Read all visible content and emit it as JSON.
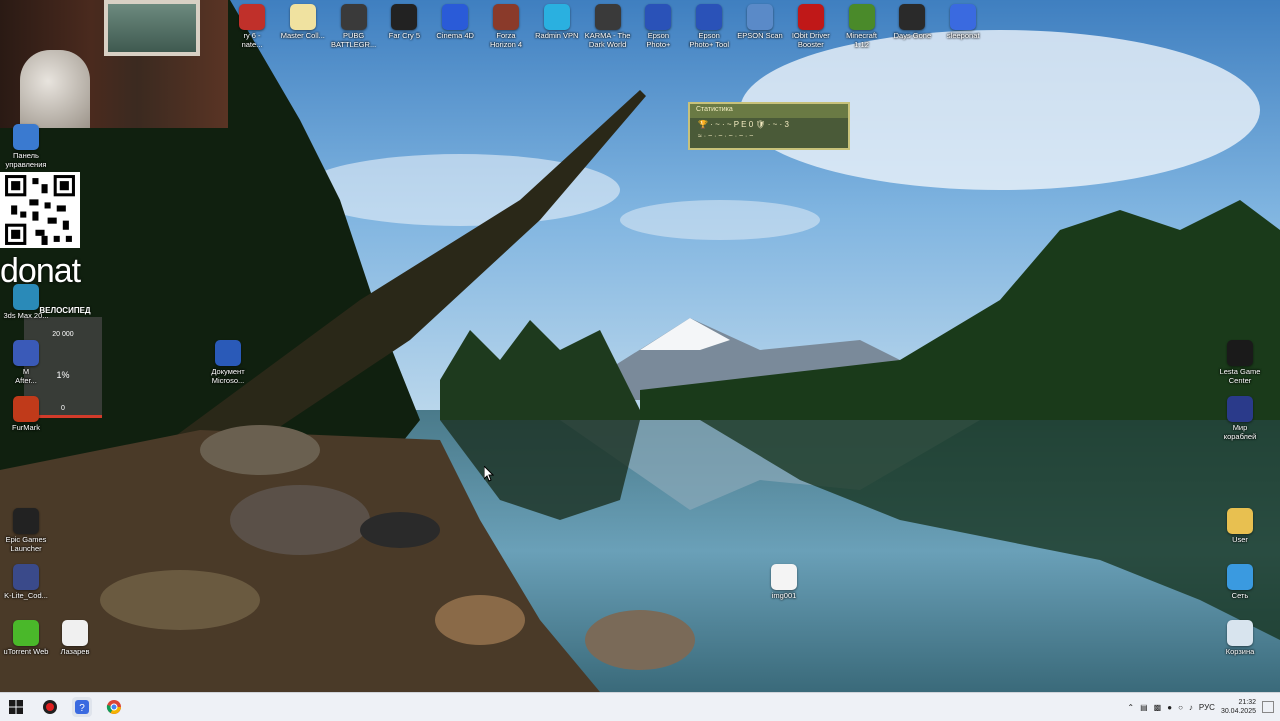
{
  "top_icons": [
    {
      "label": "ry 6 -\nnate...",
      "color": "#c0302a",
      "icon": "game-icon"
    },
    {
      "label": "Master Coll...",
      "color": "#f0e2a0",
      "icon": "folder-icon"
    },
    {
      "label": "PUBG\nBATTLEGR...",
      "color": "#3a3a3a",
      "icon": "pubg-icon"
    },
    {
      "label": "Far Cry 5",
      "color": "#222222",
      "icon": "farcry-icon"
    },
    {
      "label": "Cinema 4D",
      "color": "#2a5bd8",
      "icon": "cinema4d-icon"
    },
    {
      "label": "Forza\nHorizon 4",
      "color": "#8a3a2a",
      "icon": "forza-icon"
    },
    {
      "label": "Radmin VPN",
      "color": "#2ab0e0",
      "icon": "radmin-icon"
    },
    {
      "label": "KARMA - The\nDark World",
      "color": "#3a3a3a",
      "icon": "karma-icon"
    },
    {
      "label": "Epson\nPhoto+",
      "color": "#2a52b8",
      "icon": "epson-photo-icon"
    },
    {
      "label": "Epson\nPhoto+ Tool",
      "color": "#2a52b8",
      "icon": "epson-tool-icon"
    },
    {
      "label": "EPSON Scan",
      "color": "#5a8ac8",
      "icon": "epson-scan-icon"
    },
    {
      "label": "IObit Driver\nBooster",
      "color": "#c01818",
      "icon": "iobit-icon"
    },
    {
      "label": "Minecraft\n1.12",
      "color": "#4a8a2a",
      "icon": "minecraft-icon"
    },
    {
      "label": "Days Gone",
      "color": "#2a2a2a",
      "icon": "daysgone-icon"
    },
    {
      "label": "sleeponat",
      "color": "#3a6ae0",
      "icon": "app-icon"
    }
  ],
  "left_icons": [
    {
      "label": "Панель\nуправления",
      "color": "#3a7ad0",
      "icon": "control-panel-icon"
    },
    {
      "label": "3ds Max 20...",
      "color": "#2a8ab8",
      "icon": "3dsmax-icon"
    },
    {
      "label": "M\nAfter...",
      "color": "#3a5ab8",
      "icon": "after-effects-icon"
    },
    {
      "label": "FurMark",
      "color": "#c03a1a",
      "icon": "furmark-icon"
    },
    {
      "label": "Epic Games\nLauncher",
      "color": "#222222",
      "icon": "epic-icon"
    },
    {
      "label": "K-Lite_Cod...",
      "color": "#3a4a8a",
      "icon": "klite-icon"
    },
    {
      "label": "uTorrent Web",
      "color": "#4ab82a",
      "icon": "utorrent-icon"
    },
    {
      "label": "Лазарев",
      "color": "#f0f0f0",
      "icon": "file-icon"
    }
  ],
  "center_icons": [
    {
      "label": "Документ\nMicroso...",
      "color": "#2a5ab8",
      "icon": "word-icon"
    },
    {
      "label": "img001",
      "color": "#f4f4f4",
      "icon": "image-file-icon"
    }
  ],
  "right_icons": [
    {
      "label": "Lesta Game\nCenter",
      "color": "#1a1a1a",
      "icon": "lesta-icon"
    },
    {
      "label": "Мир\nкораблей",
      "color": "#2a3a8a",
      "icon": "ships-icon"
    },
    {
      "label": "User",
      "color": "#e8c050",
      "icon": "user-folder-icon"
    },
    {
      "label": "Сеть",
      "color": "#3a9ae0",
      "icon": "network-icon"
    },
    {
      "label": "Корзина",
      "color": "#d8e4ee",
      "icon": "recycle-bin-icon"
    }
  ],
  "overlay": {
    "donat_text": "donat",
    "goal_title": "ВЕЛОСИПЕД",
    "goal_max": "20 000",
    "goal_percent": "1%",
    "goal_min": "0",
    "goal_progress": 0.01
  },
  "stats_widget": {
    "title": "Статистика",
    "row1": "🏆 · ~ · ~ P E 0  🛡 · ~ · 3",
    "row2": "≈ · ~ · ~  ·  ~ · ~ · ~"
  },
  "taskbar": {
    "apps": [
      "windows-start",
      "recording-app",
      "sleeponat",
      "chrome"
    ],
    "tray_lang": "РУС",
    "time": "21:32",
    "date": "30.04.2025"
  },
  "colors": {
    "taskbar_bg": "#eef1f6",
    "goal_bar": "#d23b2a"
  }
}
